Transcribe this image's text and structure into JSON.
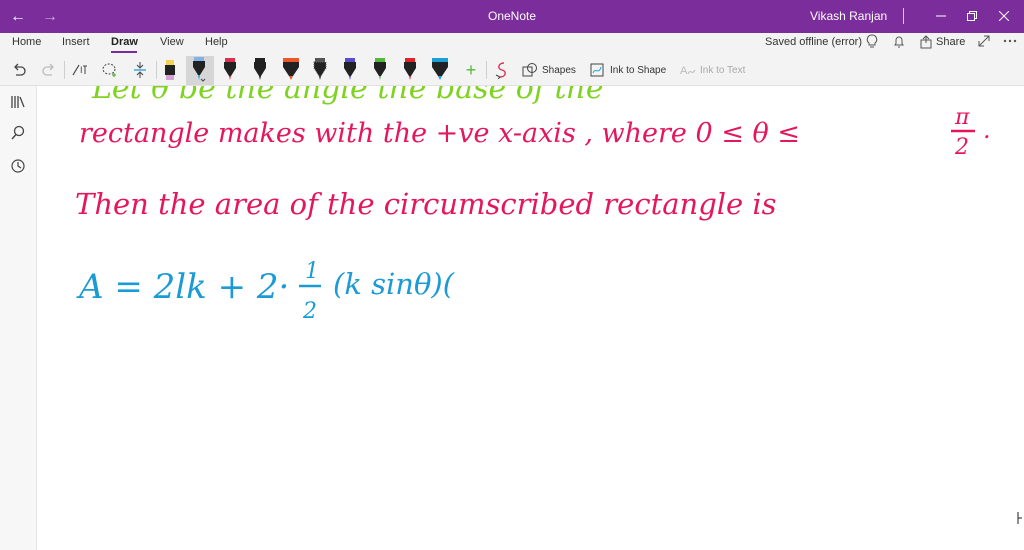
{
  "titlebar": {
    "app_title": "OneNote",
    "user_name": "Vikash Ranjan",
    "color": "#7B2D9B"
  },
  "ribbon": {
    "tabs": [
      "Home",
      "Insert",
      "Draw",
      "View",
      "Help"
    ],
    "active_tab": "Draw",
    "status": "Saved offline (error)",
    "share_label": "Share"
  },
  "toolbar": {
    "shapes_label": "Shapes",
    "ink_to_shape_label": "Ink to Shape",
    "ink_to_text_label": "Ink to Text",
    "pen_colors": [
      "#f7d154",
      "#7fb3e8",
      "#e03050",
      "#222222",
      "#e85a2a",
      "#2a2a2a",
      "#5a4bd0",
      "#55b83a",
      "#e0222a",
      "#1ba0d8"
    ],
    "add_pen": "+"
  },
  "ink": {
    "line0": "Let θ be the angle the base of the",
    "line1": "rectangle makes with the +ve x-axis , where 0 ≤ θ ≤",
    "line1_frac_num": "π",
    "line1_frac_den": "2",
    "line2": "Then the area of the circumscribed rectangle is",
    "line3": "A = 2lk + 2·",
    "line3_frac_num": "1",
    "line3_frac_den": "2",
    "line3_tail": "(k sinθ)(",
    "colors": {
      "green": "#7ed321",
      "pink": "#e5175c",
      "blue": "#1b9bd6"
    }
  }
}
